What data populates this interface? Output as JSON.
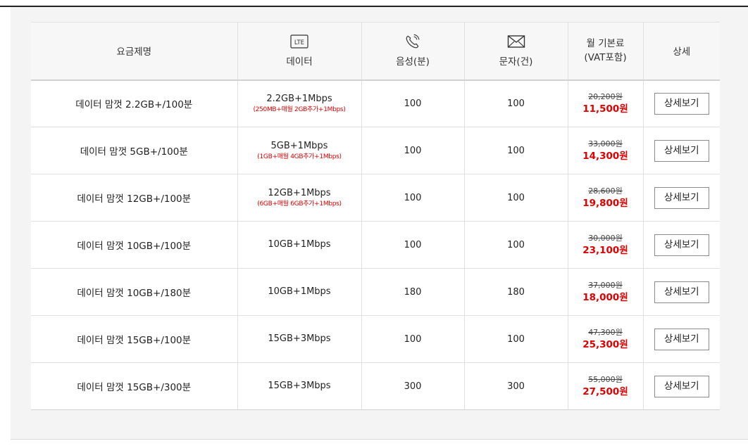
{
  "header": {
    "name_label": "요금제명",
    "data_icon_text": "LTE",
    "data_label": "데이터",
    "voice_label": "음성(분)",
    "sms_label": "문자(건)",
    "fee_label_line1": "월 기본료",
    "fee_label_line2": "(VAT포함)",
    "detail_label": "상세"
  },
  "icons": {
    "data": "lte-icon",
    "voice": "phone-icon",
    "sms": "envelope-icon"
  },
  "colors": {
    "accent_red": "#e00000",
    "header_bg": "#f7f7f7",
    "panel_bg": "#f4f4f4"
  },
  "plans": [
    {
      "name": "데이터 맘껏 2.2GB+/100분",
      "data": "2.2GB+1Mbps",
      "data_note": "(250MB+매월 2GB추가+1Mbps)",
      "voice": "100",
      "sms": "100",
      "fee_original": "20,200원",
      "fee_price": "11,500원",
      "detail_button": "상세보기"
    },
    {
      "name": "데이터 맘껏 5GB+/100분",
      "data": "5GB+1Mbps",
      "data_note": "(1GB+매월 4GB추가+1Mbps)",
      "voice": "100",
      "sms": "100",
      "fee_original": "33,000원",
      "fee_price": "14,300원",
      "detail_button": "상세보기"
    },
    {
      "name": "데이터 맘껏 12GB+/100분",
      "data": "12GB+1Mbps",
      "data_note": "(6GB+매월 6GB추가+1Mbps)",
      "voice": "100",
      "sms": "100",
      "fee_original": "28,600원",
      "fee_price": "19,800원",
      "detail_button": "상세보기"
    },
    {
      "name": "데이터 맘껏 10GB+/100분",
      "data": "10GB+1Mbps",
      "data_note": "",
      "voice": "100",
      "sms": "100",
      "fee_original": "30,000원",
      "fee_price": "23,100원",
      "detail_button": "상세보기"
    },
    {
      "name": "데이터 맘껏 10GB+/180분",
      "data": "10GB+1Mbps",
      "data_note": "",
      "voice": "180",
      "sms": "180",
      "fee_original": "37,000원",
      "fee_price": "18,000원",
      "detail_button": "상세보기"
    },
    {
      "name": "데이터 맘껏 15GB+/100분",
      "data": "15GB+3Mbps",
      "data_note": "",
      "voice": "100",
      "sms": "100",
      "fee_original": "47,300원",
      "fee_price": "25,300원",
      "detail_button": "상세보기"
    },
    {
      "name": "데이터 맘껏 15GB+/300분",
      "data": "15GB+3Mbps",
      "data_note": "",
      "voice": "300",
      "sms": "300",
      "fee_original": "55,000원",
      "fee_price": "27,500원",
      "detail_button": "상세보기"
    }
  ]
}
